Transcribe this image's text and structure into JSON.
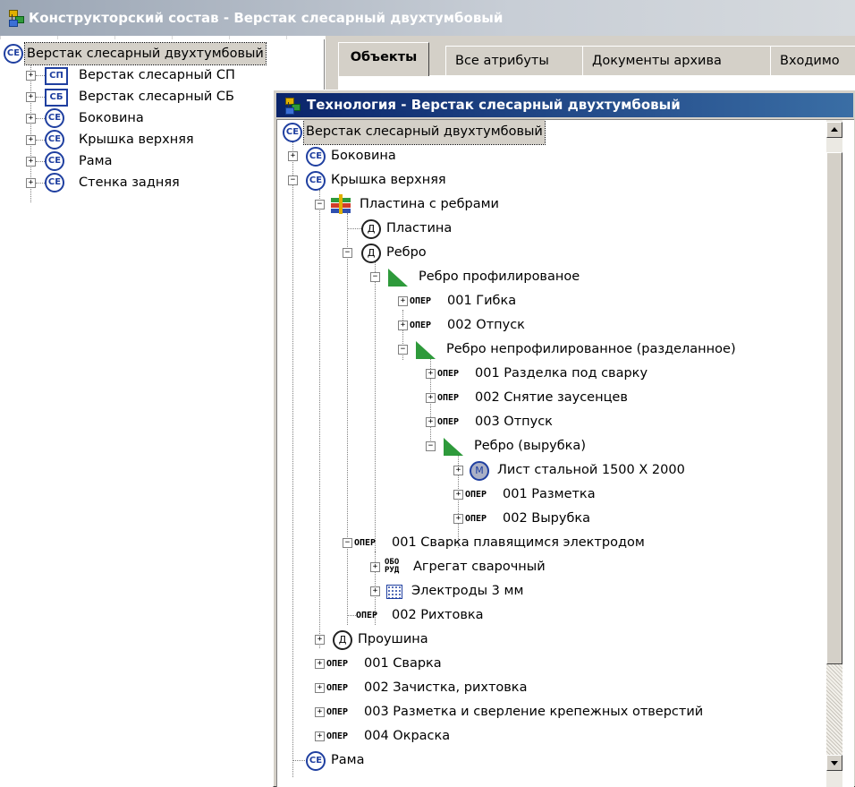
{
  "back_window": {
    "title": "Конструкторский состав - Верстак слесарный двухтумбовый",
    "left_tree": [
      {
        "icon": "СЕ",
        "label": "Верстак слесарный двухтумбовый"
      },
      {
        "icon": "СП",
        "label": "Верстак слесарный СП"
      },
      {
        "icon": "СБ",
        "label": "Верстак слесарный СБ"
      },
      {
        "icon": "СЕ",
        "label": "Боковина"
      },
      {
        "icon": "СЕ",
        "label": "Крышка верхняя"
      },
      {
        "icon": "СЕ",
        "label": "Рама"
      },
      {
        "icon": "СЕ",
        "label": "Стенка задняя"
      }
    ],
    "tabs": [
      "Объекты",
      "Все атрибуты",
      "Документы архива",
      "Входимо"
    ]
  },
  "front_window": {
    "title": "Технология - Верстак слесарный двухтумбовый",
    "tree": [
      {
        "icon": "СЕ",
        "label": "Верстак слесарный двухтумбовый"
      },
      {
        "icon": "СЕ",
        "label": "Боковина"
      },
      {
        "icon": "СЕ",
        "label": "Крышка верхняя"
      },
      {
        "icon": "plate",
        "label": "Пластина с ребрами"
      },
      {
        "icon": "Д",
        "label": "Пластина"
      },
      {
        "icon": "Д",
        "label": "Ребро"
      },
      {
        "icon": "tri",
        "label": "Ребро профилированое"
      },
      {
        "icon": "ОПЕР",
        "label": "001 Гибка"
      },
      {
        "icon": "ОПЕР",
        "label": "002 Отпуск"
      },
      {
        "icon": "tri",
        "label": "Ребро непрофилированное (разделанное)"
      },
      {
        "icon": "ОПЕР",
        "label": "001 Разделка под сварку"
      },
      {
        "icon": "ОПЕР",
        "label": "002 Снятие заусенцев"
      },
      {
        "icon": "ОПЕР",
        "label": "003 Отпуск"
      },
      {
        "icon": "tri",
        "label": "Ребро (вырубка)"
      },
      {
        "icon": "М",
        "label": "Лист стальной 1500 Х 2000"
      },
      {
        "icon": "ОПЕР",
        "label": "001 Разметка"
      },
      {
        "icon": "ОПЕР",
        "label": "002 Вырубка"
      },
      {
        "icon": "ОПЕР",
        "label": "001 Сварка плавящимся электродом"
      },
      {
        "icon": "ОБО РУД",
        "label": "Агрегат сварочный"
      },
      {
        "icon": "elec",
        "label": "Электроды 3 мм"
      },
      {
        "icon": "ОПЕР",
        "label": "002 Рихтовка"
      },
      {
        "icon": "Д",
        "label": "Проушина"
      },
      {
        "icon": "ОПЕР",
        "label": "001 Сварка"
      },
      {
        "icon": "ОПЕР",
        "label": "002 Зачистка, рихтовка"
      },
      {
        "icon": "ОПЕР",
        "label": "003 Разметка и сверление крепежных отверстий"
      },
      {
        "icon": "ОПЕР",
        "label": "004 Окраска"
      },
      {
        "icon": "СЕ",
        "label": "Рама"
      }
    ]
  },
  "icon_text": {
    "ce": "СЕ",
    "sp": "СП",
    "sb": "СБ",
    "d": "Д",
    "m": "М",
    "oper": "ОПЕР",
    "obo": "ОБО",
    "rud": "РУД"
  },
  "colors": {
    "title_active": "#0a246a",
    "title_inactive": "#9aa5b4",
    "icon_blue": "#1f3fa0",
    "icon_green": "#2e9a3b"
  }
}
